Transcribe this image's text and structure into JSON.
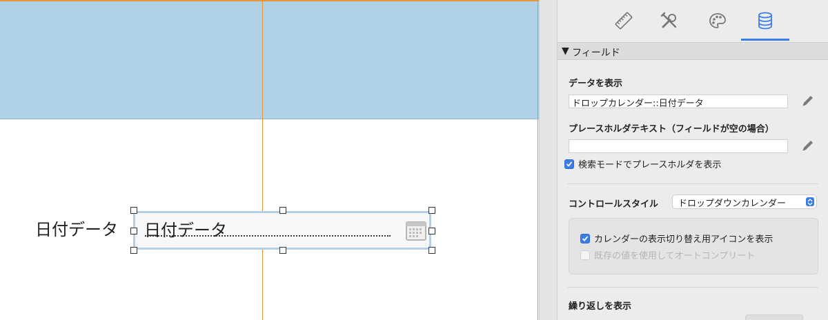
{
  "canvas": {
    "field_label": "日付データ",
    "field_value": "日付データ",
    "colors": {
      "header_band": "#afd1e5",
      "guide": "#e8943a",
      "selection": "#b7cfe6"
    }
  },
  "inspector": {
    "tabs": [
      {
        "icon": "ruler-icon",
        "active": false
      },
      {
        "icon": "tools-icon",
        "active": false
      },
      {
        "icon": "palette-icon",
        "active": false
      },
      {
        "icon": "database-icon",
        "active": true
      }
    ],
    "section_title": "フィールド",
    "section_toggle": "▼",
    "display_data": {
      "label": "データを表示",
      "value": "ドロップカレンダー::日付データ"
    },
    "placeholder": {
      "label": "プレースホルダテキスト（フィールドが空の場合）",
      "value": "",
      "show_in_find_mode": {
        "label": "検索モードでプレースホルダを表示",
        "checked": true
      }
    },
    "control_style": {
      "label": "コントロールスタイル",
      "selected": "ドロップダウンカレンダー",
      "options": [
        {
          "label": "カレンダーの表示切り替え用アイコンを表示",
          "checked": true,
          "enabled": true
        },
        {
          "label": "既存の値を使用してオートコンプリート",
          "checked": false,
          "enabled": false
        }
      ]
    },
    "repetitions": {
      "label": "繰り返しを表示"
    },
    "accent_color": "#3a7de8"
  }
}
